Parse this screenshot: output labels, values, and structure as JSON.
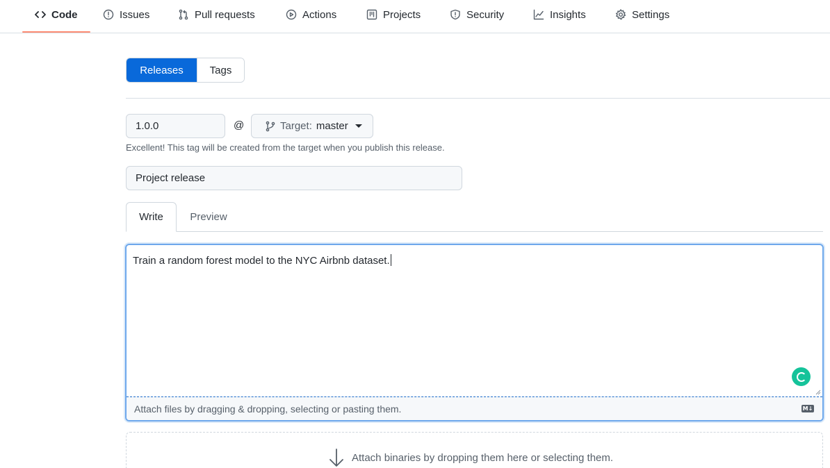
{
  "repo_nav": {
    "items": [
      {
        "label": "Code",
        "icon": "code-icon",
        "selected": true
      },
      {
        "label": "Issues",
        "icon": "issue-opened-icon",
        "selected": false
      },
      {
        "label": "Pull requests",
        "icon": "git-pull-request-icon",
        "selected": false
      },
      {
        "label": "Actions",
        "icon": "play-icon",
        "selected": false
      },
      {
        "label": "Projects",
        "icon": "table-icon",
        "selected": false
      },
      {
        "label": "Security",
        "icon": "shield-icon",
        "selected": false
      },
      {
        "label": "Insights",
        "icon": "graph-icon",
        "selected": false
      },
      {
        "label": "Settings",
        "icon": "gear-icon",
        "selected": false
      }
    ],
    "accent_underline": "#fd8c73"
  },
  "release_tabs": {
    "releases": "Releases",
    "tags": "Tags",
    "active_color": "#0969da"
  },
  "tag_form": {
    "tag_value": "1.0.0",
    "at_symbol": "@",
    "target_label": "Target:",
    "target_value": "master",
    "hint": "Excellent! This tag will be created from the target when you publish this release."
  },
  "title_field": {
    "value": "Project release"
  },
  "editor": {
    "tab_write": "Write",
    "tab_preview": "Preview",
    "body": "Train a random forest model to the NYC Airbnb dataset.",
    "attach_hint": "Attach files by dragging & dropping, selecting or pasting them.",
    "markdown_badge": "M↓"
  },
  "binaries": {
    "hint": "Attach binaries by dropping them here or selecting them."
  }
}
